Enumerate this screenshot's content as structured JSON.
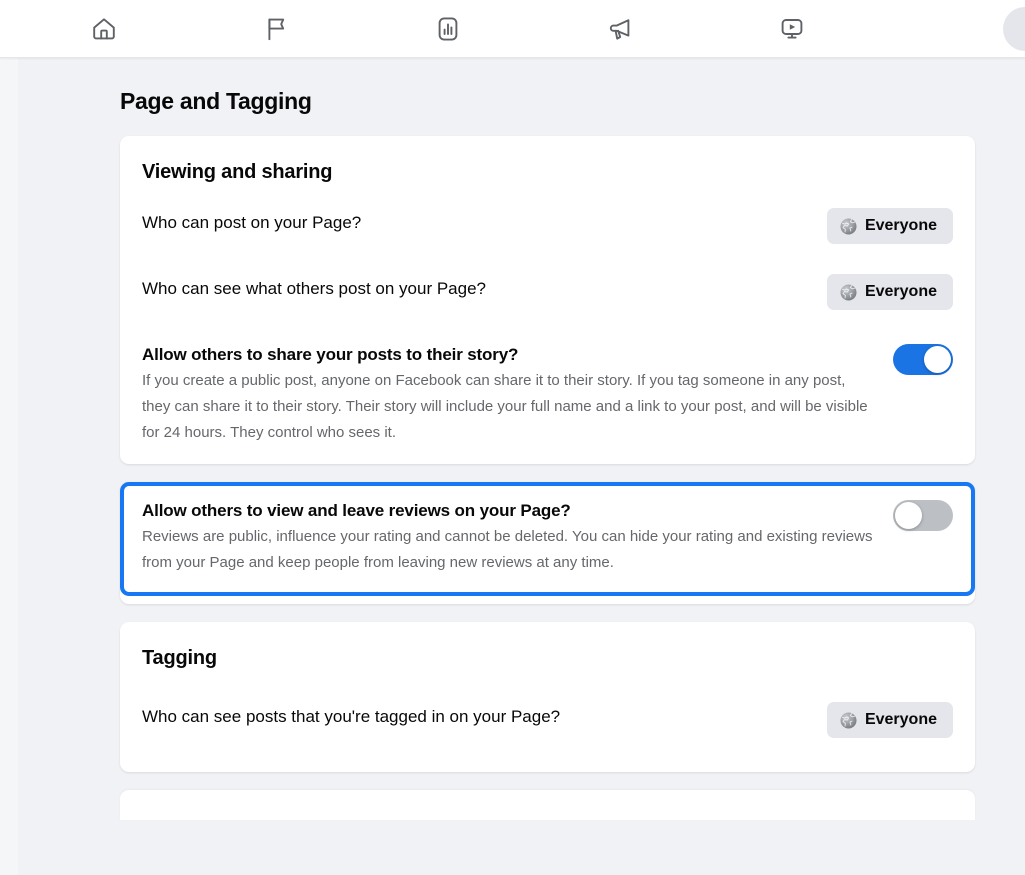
{
  "topnav": {
    "items": [
      {
        "name": "home-icon",
        "label": "Home"
      },
      {
        "name": "flag-icon",
        "label": "Pages"
      },
      {
        "name": "bar-chart-icon",
        "label": "Insights"
      },
      {
        "name": "megaphone-icon",
        "label": "Ads"
      },
      {
        "name": "video-icon",
        "label": "Video"
      }
    ],
    "avatar_label": "Profile"
  },
  "page": {
    "title": "Page and Tagging"
  },
  "viewing_and_sharing": {
    "heading": "Viewing and sharing",
    "rows": [
      {
        "label": "Who can post on your Page?",
        "control": "audience",
        "value": "Everyone"
      },
      {
        "label": "Who can see what others post on your Page?",
        "control": "audience",
        "value": "Everyone"
      },
      {
        "label": "Allow others to share your posts to their story?",
        "description": "If you create a public post, anyone on Facebook can share it to their story. If you tag someone in any post, they can share it to their story. Their story will include your full name and a link to your post, and will be visible for 24 hours. They control who sees it.",
        "control": "toggle",
        "state": "on"
      }
    ],
    "highlighted_row": {
      "label": "Allow others to view and leave reviews on your Page?",
      "description": "Reviews are public, influence your rating and cannot be deleted. You can hide your rating and existing reviews from your Page and keep people from leaving new reviews at any time.",
      "control": "toggle",
      "state": "off"
    }
  },
  "tagging": {
    "heading": "Tagging",
    "rows": [
      {
        "label": "Who can see posts that you're tagged in on your Page?",
        "control": "audience",
        "value": "Everyone"
      }
    ]
  },
  "colors": {
    "accent_blue": "#1877f2",
    "toggle_on": "#1b74e4",
    "toggle_off": "#bcc0c4",
    "page_background": "#f0f2f5",
    "card_background": "#ffffff",
    "text_primary": "#080809",
    "text_secondary": "#65676b",
    "button_background": "#e4e6eb"
  }
}
